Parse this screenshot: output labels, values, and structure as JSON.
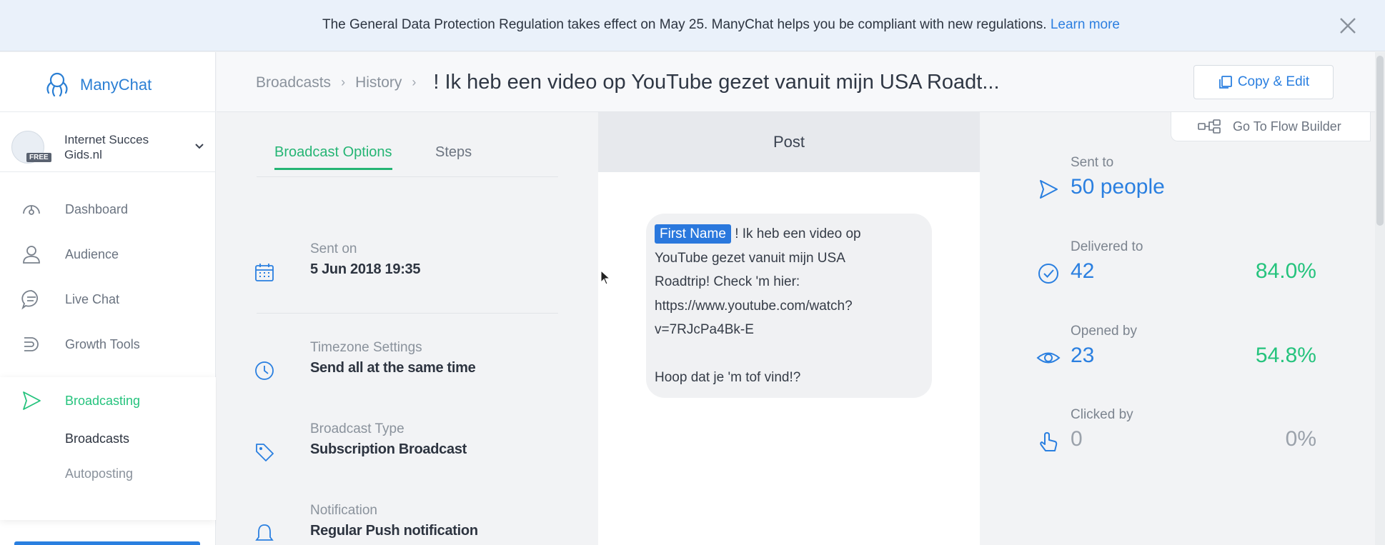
{
  "banner": {
    "text": "The General Data Protection Regulation takes effect on May 25. ManyChat helps you be compliant with new regulations.",
    "link": "Learn more"
  },
  "sidebar": {
    "brand": "ManyChat",
    "account": {
      "name": "Internet Succes Gids.nl",
      "badge": "FREE"
    },
    "nav": [
      {
        "label": "Dashboard"
      },
      {
        "label": "Audience"
      },
      {
        "label": "Live Chat"
      },
      {
        "label": "Growth Tools"
      },
      {
        "label": "Broadcasting"
      }
    ],
    "subnav": [
      {
        "label": "Broadcasts"
      },
      {
        "label": "Autoposting"
      }
    ]
  },
  "header": {
    "crumbs": [
      "Broadcasts",
      "History"
    ],
    "title": "! Ik heb een video op YouTube gezet vanuit mijn USA Roadt...",
    "copy_label": "Copy & Edit"
  },
  "options": {
    "tabs": [
      "Broadcast Options",
      "Steps"
    ],
    "sent_on": {
      "label": "Sent on",
      "value": "5 Jun 2018 19:35"
    },
    "timezone": {
      "label": "Timezone Settings",
      "value": "Send all at the same time"
    },
    "type": {
      "label": "Broadcast Type",
      "value": "Subscription Broadcast"
    },
    "notification": {
      "label": "Notification",
      "value": "Regular Push notification"
    }
  },
  "post": {
    "title": "Post",
    "chip": "First Name",
    "lines": [
      "! Ik heb een video op",
      "YouTube gezet vanuit mijn USA",
      "Roadtrip! Check 'm hier:",
      "https://www.youtube.com/watch?",
      "v=7RJcPa4Bk-E",
      "",
      "Hoop dat je 'm tof vind!?"
    ]
  },
  "stats": {
    "flow_label": "Go To Flow Builder",
    "sent": {
      "label": "Sent to",
      "value": "50 people"
    },
    "delivered": {
      "label": "Delivered to",
      "value": "42",
      "pct": "84.0%"
    },
    "opened": {
      "label": "Opened by",
      "value": "23",
      "pct": "54.8%"
    },
    "clicked": {
      "label": "Clicked by",
      "value": "0",
      "pct": "0%"
    }
  }
}
